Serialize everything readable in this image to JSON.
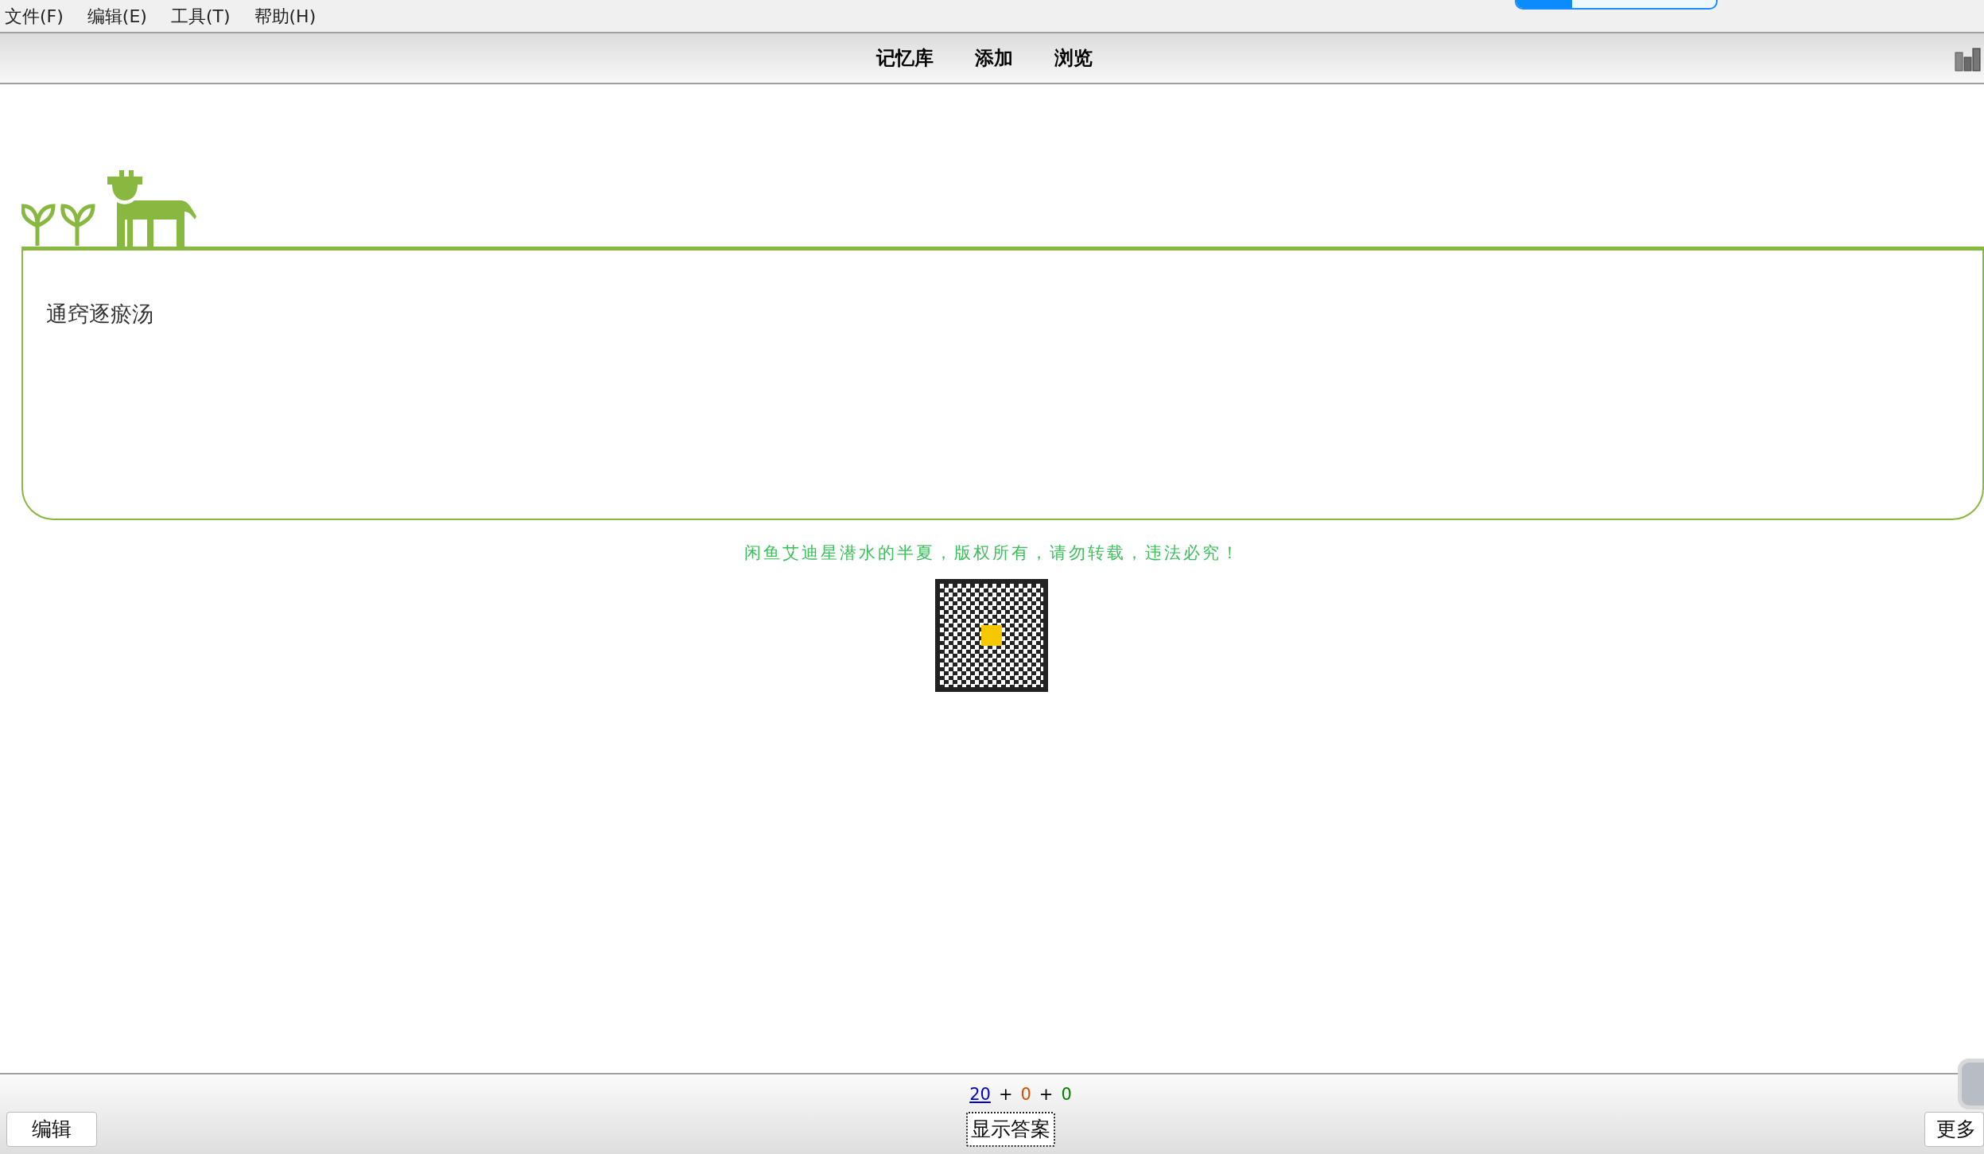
{
  "menu": [
    {
      "label": "文件(F)"
    },
    {
      "label": "编辑(E)"
    },
    {
      "label": "工具(T)"
    },
    {
      "label": "帮助(H)"
    }
  ],
  "toolbar": {
    "links": [
      {
        "label": "记忆库"
      },
      {
        "label": "添加"
      },
      {
        "label": "浏览"
      }
    ]
  },
  "card": {
    "question": "通窍逐瘀汤",
    "notice": "闲鱼艾迪星潜水的半夏，版权所有，请勿转载，违法必究！"
  },
  "bottom_bar": {
    "edit_button": "编辑",
    "counts": [
      {
        "text": "20",
        "color": "#0000cc",
        "selected": true
      },
      {
        "text": "0",
        "color": "#d05000",
        "selected": false
      },
      {
        "text": "0",
        "color": "#008000",
        "selected": false
      }
    ],
    "separator": "+",
    "answer_button": "显示答案",
    "more_button": "更多"
  }
}
